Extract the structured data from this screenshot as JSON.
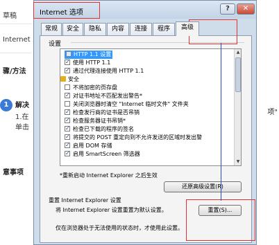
{
  "background": {
    "items": [
      {
        "text": "草稿"
      },
      {
        "text": "Internet"
      },
      {
        "text": "骤/方法"
      },
      {
        "text": "解决"
      },
      {
        "text": "1.在"
      },
      {
        "text": "单击"
      },
      {
        "text": "意事项"
      }
    ],
    "step_number": "1",
    "right_text": "项\""
  },
  "dialog": {
    "title": "Internet 选项",
    "help_button": "?",
    "close_button": "✕",
    "tabs": [
      {
        "label": "常规"
      },
      {
        "label": "安全"
      },
      {
        "label": "隐私"
      },
      {
        "label": "内容"
      },
      {
        "label": "连接"
      },
      {
        "label": "程序"
      },
      {
        "label": "高级"
      }
    ],
    "settings_label": "设置",
    "list_items": [
      {
        "text": "HTTP 1.1 设置",
        "checked": false,
        "selected": true
      },
      {
        "text": "使用 HTTP 1.1",
        "checked": true
      },
      {
        "text": "通过代理连接使用 HTTP 1.1",
        "checked": true
      },
      {
        "text": "安全",
        "checked": false
      },
      {
        "text": "不将加密的页存盘",
        "checked": false
      },
      {
        "text": "对证书地址不匹配发出警告*",
        "checked": true
      },
      {
        "text": "关闭浏览器时清空 \"Internet 临时文件\" 文件夹",
        "checked": false
      },
      {
        "text": "检查发行商的证书是否吊销",
        "checked": true
      },
      {
        "text": "检查服务器证书吊销*",
        "checked": true
      },
      {
        "text": "检查已下载的程序的签名",
        "checked": true
      },
      {
        "text": "将提交的 POST 重定向到不允许发送的区域时发出警",
        "checked": true
      },
      {
        "text": "启用 DOM 存储",
        "checked": true
      },
      {
        "text": "启用 SmartScreen 筛选器",
        "checked": true
      }
    ],
    "restart_note": "*重新启动 Internet Explorer 之后生效",
    "restore_button": "还原高级设置(R)",
    "reset_group_label": "重置 Internet Explorer 设置",
    "reset_description": "将 Internet Explorer 设置重置为默认设置。",
    "reset_button": "重置(S)...",
    "warning": "仅在浏览器处于无法使用的状态时，才使用此设置。"
  },
  "colors": {
    "annotation_red": "#e03030",
    "annotation_blue": "#2d49c9",
    "selection": "#3399ff"
  }
}
